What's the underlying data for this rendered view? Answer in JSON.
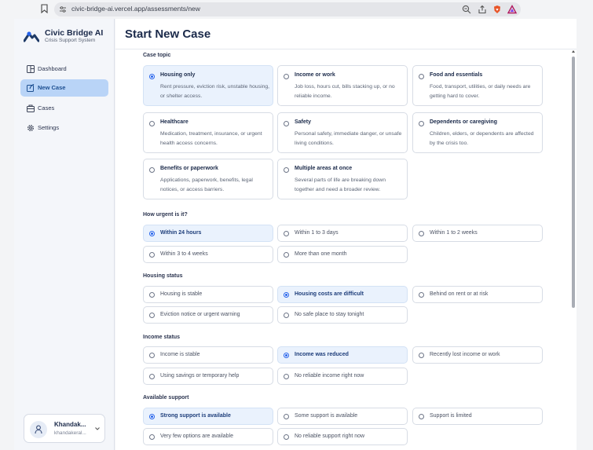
{
  "browser": {
    "url": "civic-bridge-ai.vercel.app/assessments/new"
  },
  "sidebar": {
    "brand": "Civic Bridge AI",
    "subtitle": "Crisis Support System",
    "items": [
      {
        "label": "Dashboard",
        "icon": "dashboard-icon"
      },
      {
        "label": "New Case",
        "icon": "new-case-icon",
        "active": true
      },
      {
        "label": "Cases",
        "icon": "cases-icon"
      },
      {
        "label": "Settings",
        "icon": "settings-icon"
      }
    ],
    "user": {
      "name": "Khandak...",
      "email": "khandakeral..."
    }
  },
  "main": {
    "title": "Start New Case",
    "sections": [
      {
        "label": "Case topic",
        "options": [
          {
            "label": "Housing only",
            "desc": "Rent pressure, eviction risk, unstable housing, or shelter access.",
            "selected": true
          },
          {
            "label": "Income or work",
            "desc": "Job loss, hours cut, bills stacking up, or no reliable income."
          },
          {
            "label": "Food and essentials",
            "desc": "Food, transport, utilities, or daily needs are getting hard to cover."
          },
          {
            "label": "Healthcare",
            "desc": "Medication, treatment, insurance, or urgent health access concerns."
          },
          {
            "label": "Safety",
            "desc": "Personal safety, immediate danger, or unsafe living conditions."
          },
          {
            "label": "Dependents or caregiving",
            "desc": "Children, elders, or dependents are affected by the crisis too."
          },
          {
            "label": "Benefits or paperwork",
            "desc": "Applications, paperwork, benefits, legal notices, or access barriers."
          },
          {
            "label": "Multiple areas at once",
            "desc": "Several parts of life are breaking down together and need a broader review."
          }
        ]
      },
      {
        "label": "How urgent is it?",
        "options": [
          {
            "label": "Within 24 hours",
            "selected": true
          },
          {
            "label": "Within 1 to 3 days"
          },
          {
            "label": "Within 1 to 2 weeks"
          },
          {
            "label": "Within 3 to 4 weeks"
          },
          {
            "label": "More than one month"
          }
        ]
      },
      {
        "label": "Housing status",
        "options": [
          {
            "label": "Housing is stable"
          },
          {
            "label": "Housing costs are difficult",
            "selected": true
          },
          {
            "label": "Behind on rent or at risk"
          },
          {
            "label": "Eviction notice or urgent warning"
          },
          {
            "label": "No safe place to stay tonight"
          }
        ]
      },
      {
        "label": "Income status",
        "options": [
          {
            "label": "Income is stable"
          },
          {
            "label": "Income was reduced",
            "selected": true
          },
          {
            "label": "Recently lost income or work"
          },
          {
            "label": "Using savings or temporary help"
          },
          {
            "label": "No reliable income right now"
          }
        ]
      },
      {
        "label": "Available support",
        "options": [
          {
            "label": "Strong support is available",
            "selected": true
          },
          {
            "label": "Some support is available"
          },
          {
            "label": "Support is limited"
          },
          {
            "label": "Very few options are available"
          },
          {
            "label": "No reliable support right now"
          }
        ]
      }
    ]
  },
  "colors": {
    "accent": "#2563eb",
    "active_nav": "#b9d4f7",
    "selected_option": "#eaf2fd",
    "brand_text": "#1b2a4a"
  }
}
